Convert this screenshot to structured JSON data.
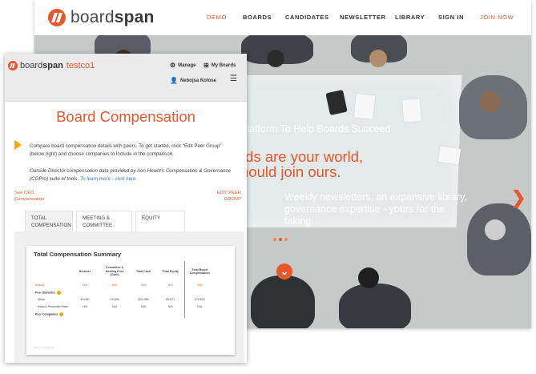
{
  "website": {
    "logo_prefix": "board",
    "logo_bold": "span",
    "nav": [
      {
        "label": "DEMO",
        "accent": true
      },
      {
        "label": "BOARDS",
        "accent": false
      },
      {
        "label": "CANDIDATES",
        "accent": false
      },
      {
        "label": "NEWSLETTER",
        "accent": false
      },
      {
        "label": "LIBRARY",
        "accent": false
      },
      {
        "label": "SIGN IN",
        "accent": false
      },
      {
        "label": "JOIN NOW",
        "accent": true
      }
    ],
    "hero": {
      "tagline": "Platform To Help Boards Succeed",
      "headline": "rds are your world,\nhould join ours.",
      "subtext": "Weekly newsletters, an expansive library, governance expertise - yours for the taking.",
      "next_arrow_icon": "chevron-right-icon",
      "scroll_down_icon": "chevron-down-icon",
      "slide_count": 3
    }
  },
  "app": {
    "logo_prefix": "board",
    "logo_bold": "span",
    "org_name": "testco1",
    "menu": {
      "manage_label": "Manage",
      "my_boards_label": "My Boards",
      "user_name": "Nebojsa Kolose"
    },
    "page_title": "Board Compensation",
    "intro_text": "Compare board compensation details with peers. To get started, click \"Edit Peer Group\" (below right) and choose companies to include in the comparison.",
    "credit_text": "Outside Director compensation data provided by Aon Hewitt's Compensation & Governance (CGPro) suite of tools.",
    "credit_link": "To learn more - click here.",
    "see_ceo_link": "See CEO Compensation",
    "edit_peer_link": "EDIT PEER GROUP",
    "tabs": [
      {
        "label": "TOTAL COMPENSATION",
        "active": true
      },
      {
        "label": "MEETING & COMMITTEE",
        "active": false
      },
      {
        "label": "EQUITY",
        "active": false
      }
    ],
    "summary": {
      "title": "Total Compensation Summary",
      "columns": [
        "",
        "Retainer",
        "Committee & Meeting Fees (Cash)",
        "Total Cash",
        "Total Equity",
        "Total Board Compensation"
      ],
      "org_row": {
        "label": "testco1",
        "values": [
          "N/A",
          "N/A",
          "N/A",
          "N/A",
          "N/A"
        ]
      },
      "peer_stats_label": "Peer Statistics",
      "mean_row": {
        "label": "Mean",
        "values": [
          "90,000",
          "13,956",
          "103,956",
          "69,577",
          "173,533"
        ]
      },
      "percentile_row": {
        "label": "testco1 Percentile Rank",
        "values": [
          "N/A",
          "N/A",
          "N/A",
          "N/A",
          "N/A"
        ]
      },
      "peer_companies_label": "Peer Companies",
      "footer_note": "Source: Aon Hewitt"
    }
  }
}
